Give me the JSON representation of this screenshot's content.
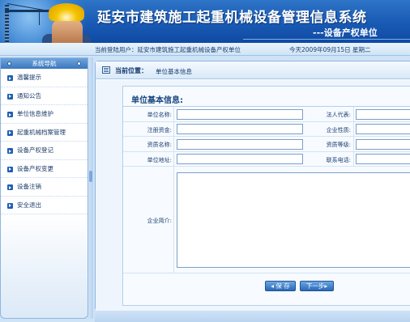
{
  "header": {
    "title": "延安市建筑施工起重机械设备管理信息系统",
    "subtitle": "---设备产权单位"
  },
  "status": {
    "user_text": "当前登陆用户：延安市建筑施工起重机械设备产权单位",
    "date_text": "今天2009年09月15日   星期二"
  },
  "sidebar": {
    "title": "系统导航",
    "items": [
      {
        "label": "温馨提示"
      },
      {
        "label": "通知公告"
      },
      {
        "label": "单位信息维护"
      },
      {
        "label": "起重机械档案管理"
      },
      {
        "label": "设备产权登记"
      },
      {
        "label": "设备产权变更"
      },
      {
        "label": "设备注销"
      },
      {
        "label": "安全退出"
      }
    ]
  },
  "location": {
    "label": "当前位置：",
    "value": "单位基本信息"
  },
  "form": {
    "section_title": "单位基本信息:",
    "rows": [
      {
        "left_label": "单位名称:",
        "left_value": "",
        "right_label": "法人代表:",
        "right_value": ""
      },
      {
        "left_label": "注册资金:",
        "left_value": "",
        "right_label": "企业性质:",
        "right_value": ""
      },
      {
        "left_label": "资质名称:",
        "left_value": "",
        "right_label": "资质等级:",
        "right_value": ""
      },
      {
        "left_label": "单位地址:",
        "left_value": "",
        "right_label": "联系电话:",
        "right_value": ""
      }
    ],
    "intro_label": "企业简介:",
    "intro_value": "",
    "save_button": "◂ 保 存",
    "next_button": "下一步▸"
  },
  "colors": {
    "header_blue": "#195ab4",
    "nav_bullet": "#1f5fb0",
    "button_blue": "#2a69b8",
    "label_text": "#1d3f72"
  }
}
